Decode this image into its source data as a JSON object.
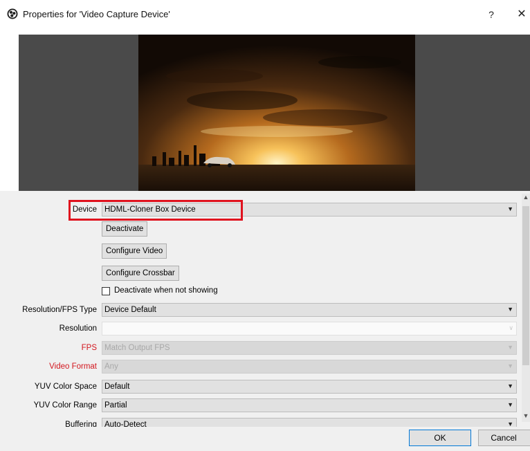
{
  "window": {
    "title": "Properties for 'Video Capture Device'",
    "help_label": "?",
    "close_label": "✕",
    "app_icon": "obs-logo-icon"
  },
  "preview": {
    "description_icon": "video-preview"
  },
  "form": {
    "device": {
      "label": "Device",
      "value": "HDML-Cloner Box Device"
    },
    "deactivate_button": "Deactivate",
    "configure_video_button": "Configure Video",
    "configure_crossbar_button": "Configure Crossbar",
    "deactivate_when_not_showing": {
      "label": "Deactivate when not showing",
      "checked": false
    },
    "resolution_fps_type": {
      "label": "Resolution/FPS Type",
      "value": "Device Default"
    },
    "resolution": {
      "label": "Resolution",
      "value": ""
    },
    "fps": {
      "label": "FPS",
      "value": "Match Output FPS"
    },
    "video_format": {
      "label": "Video Format",
      "value": "Any"
    },
    "yuv_color_space": {
      "label": "YUV Color Space",
      "value": "Default"
    },
    "yuv_color_range": {
      "label": "YUV Color Range",
      "value": "Partial"
    },
    "buffering": {
      "label": "Buffering",
      "value": "Auto-Detect"
    }
  },
  "footer": {
    "ok_button": "OK",
    "cancel_button": "Cancel"
  },
  "colors": {
    "highlight": "#e0121e",
    "required_label": "#d2161e",
    "ok_border": "#0078d7"
  }
}
